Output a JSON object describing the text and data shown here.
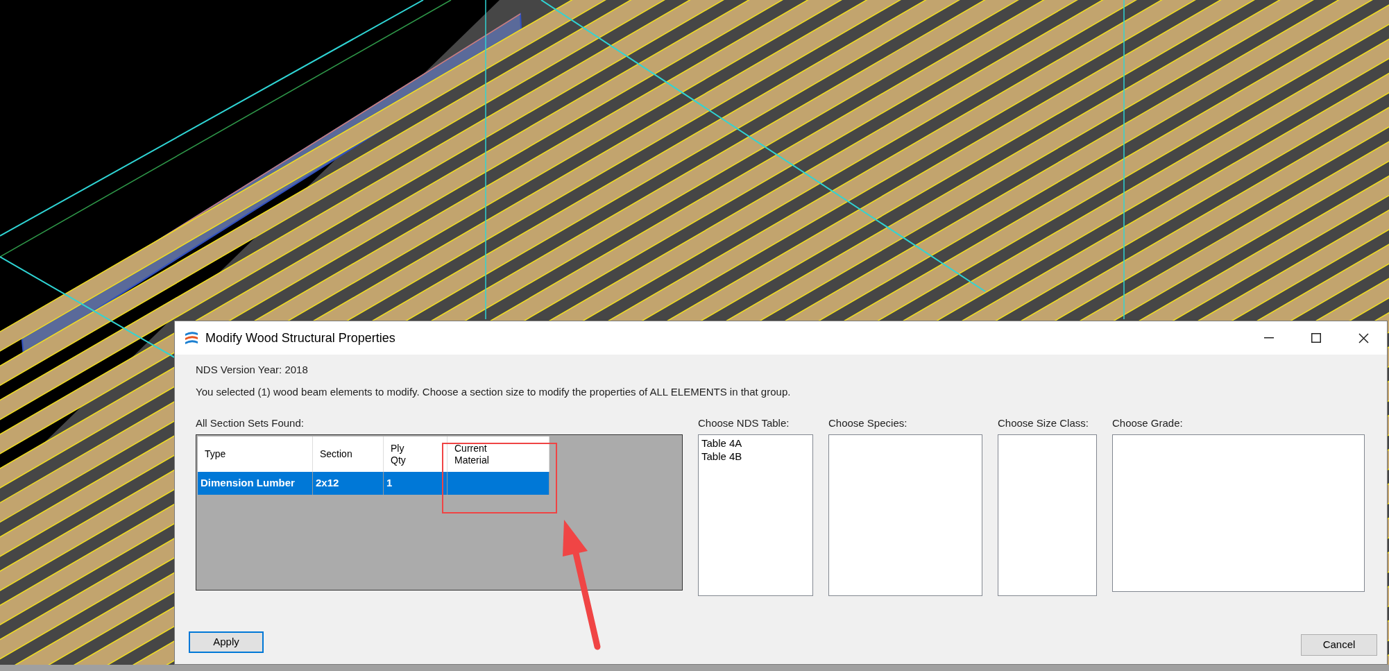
{
  "window": {
    "title": "Modify Wood Structural Properties"
  },
  "nds_version": "NDS Version Year: 2018",
  "instructions": "You selected (1) wood beam elements to modify. Choose a section size to modify the properties of ALL ELEMENTS in that group.",
  "section_sets": {
    "label": "All Section Sets Found:",
    "columns": [
      "Type",
      "Section",
      "Ply Qty",
      "Current Material"
    ],
    "rows": [
      {
        "cells": [
          "Dimension Lumber",
          "2x12",
          "1"
        ],
        "selected": true
      }
    ]
  },
  "lists": [
    {
      "label": "Choose NDS Table:",
      "items": [
        "Table 4A",
        "Table 4B"
      ]
    },
    {
      "label": "Choose Species:"
    },
    {
      "label": "Choose Size Class:"
    },
    {
      "label": "Choose Grade:"
    }
  ],
  "buttons": [
    {
      "label": "Apply",
      "focused": true
    },
    {
      "label": "Cancel",
      "focused": false
    }
  ]
}
